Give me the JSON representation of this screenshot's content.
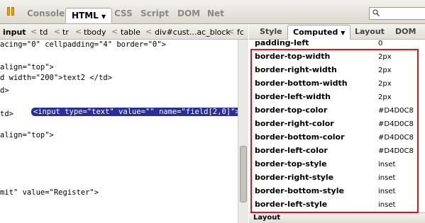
{
  "toolbar": {
    "tabs": [
      "Console",
      "HTML",
      "CSS",
      "Script",
      "DOM",
      "Net"
    ],
    "active_tab": "HTML"
  },
  "breadcrumb": [
    "input",
    "td",
    "tr",
    "tbody",
    "table",
    "div#cust...ac_block",
    "fc"
  ],
  "code_lines": [
    "acing=\"0\" cellpadding=\"4\" border=\"0\">",
    "",
    "align=\"top\">",
    "d width=\"200\">text2 </td>",
    "d>",
    "<input type=\"text\" value=\"\" name=\"field[2,0]\">",
    "td>",
    "",
    "align=\"top\">",
    "",
    "",
    "",
    "",
    "mit\" value=\"Register\">"
  ],
  "side_tabs": [
    "Style",
    "Computed",
    "Layout",
    "DOM"
  ],
  "active_side_tab": "Computed",
  "properties": [
    {
      "name": "padding-left",
      "value": "0"
    },
    {
      "name": "border-top-width",
      "value": "2px"
    },
    {
      "name": "border-right-width",
      "value": "2px"
    },
    {
      "name": "border-bottom-width",
      "value": "2px"
    },
    {
      "name": "border-left-width",
      "value": "2px"
    },
    {
      "name": "border-top-color",
      "value": "#D4D0C8"
    },
    {
      "name": "border-right-color",
      "value": "#D4D0C8"
    },
    {
      "name": "border-bottom-color",
      "value": "#D4D0C8"
    },
    {
      "name": "border-left-color",
      "value": "#D4D0C8"
    },
    {
      "name": "border-top-style",
      "value": "inset"
    },
    {
      "name": "border-right-style",
      "value": "inset"
    },
    {
      "name": "border-bottom-style",
      "value": "inset"
    },
    {
      "name": "border-left-style",
      "value": "inset"
    }
  ],
  "layout_section": "Layout",
  "colors": {
    "highlight": "#e0141e",
    "selection": "#2a2f96"
  }
}
